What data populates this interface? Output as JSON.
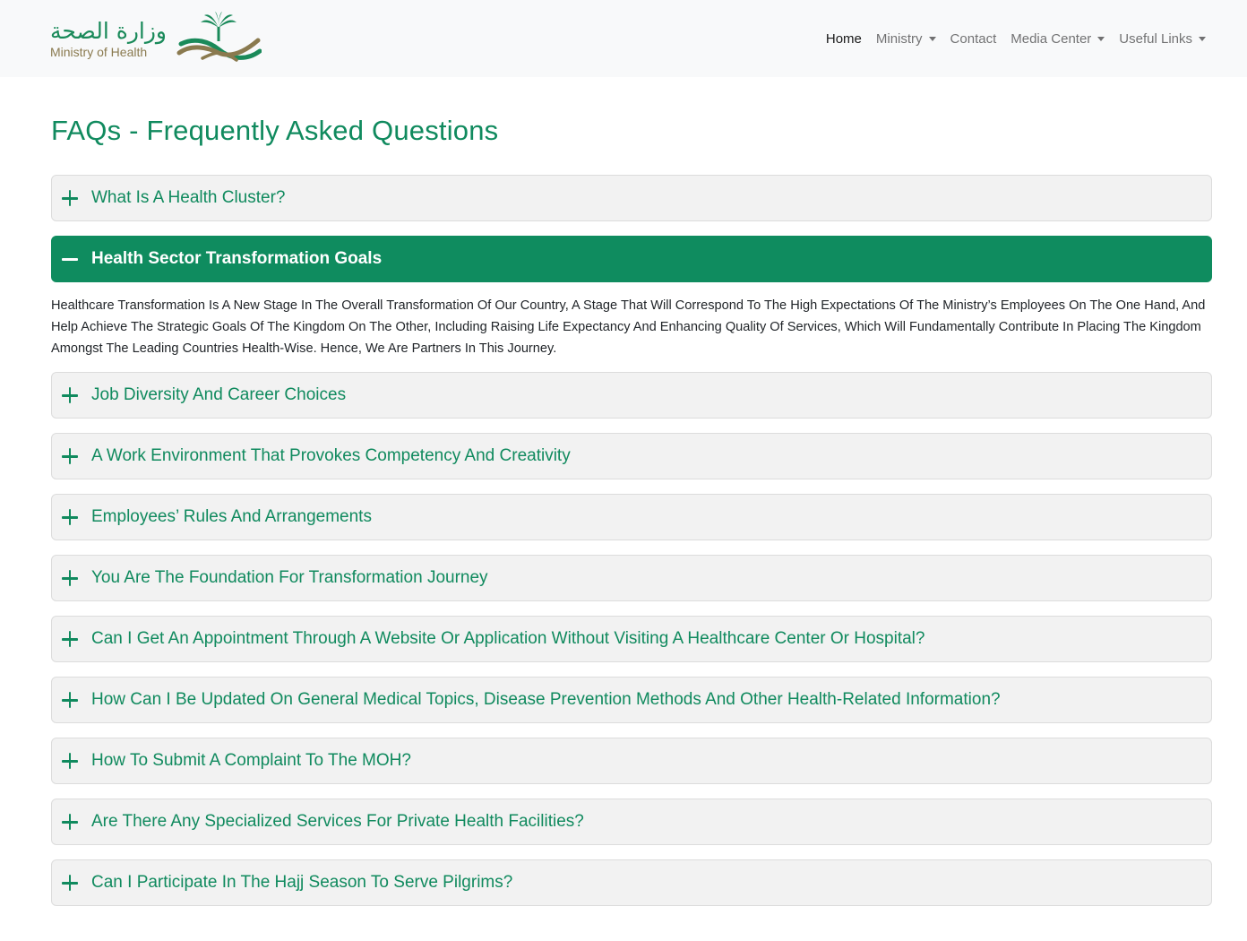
{
  "brand": {
    "arabic_name": "وزارة الصحة",
    "english_name": "Ministry of Health"
  },
  "nav": {
    "items": [
      {
        "label": "Home",
        "active": true,
        "dropdown": false
      },
      {
        "label": "Ministry",
        "active": false,
        "dropdown": true
      },
      {
        "label": "Contact",
        "active": false,
        "dropdown": false
      },
      {
        "label": "Media Center",
        "active": false,
        "dropdown": true
      },
      {
        "label": "Useful Links",
        "active": false,
        "dropdown": true
      }
    ]
  },
  "page": {
    "title": "FAQs - Frequently Asked Questions"
  },
  "faqs": [
    {
      "question": "What Is A Health Cluster?",
      "expanded": false
    },
    {
      "question": "Health Sector Transformation Goals",
      "expanded": true,
      "answer": "Healthcare Transformation Is A New Stage In The Overall Transformation Of Our Country, A Stage That Will Correspond To The High Expectations Of The Ministry’s Employees On The One Hand, And Help Achieve The Strategic Goals Of The Kingdom On The Other, Including Raising Life Expectancy And Enhancing Quality Of Services, Which Will Fundamentally Contribute In Placing The Kingdom Amongst The Leading Countries Health-Wise. Hence, We Are Partners In This Journey."
    },
    {
      "question": "Job Diversity And Career Choices",
      "expanded": false
    },
    {
      "question": "A Work Environment That Provokes Competency And Creativity",
      "expanded": false
    },
    {
      "question": "Employees’ Rules And Arrangements",
      "expanded": false
    },
    {
      "question": "You Are The Foundation For Transformation Journey",
      "expanded": false
    },
    {
      "question": "Can I Get An Appointment Through A Website Or Application Without Visiting A Healthcare Center Or Hospital?",
      "expanded": false
    },
    {
      "question": "How Can I Be Updated On General Medical Topics, Disease Prevention Methods And Other Health-Related Information?",
      "expanded": false
    },
    {
      "question": "How To Submit A Complaint To The MOH?",
      "expanded": false
    },
    {
      "question": "Are There Any Specialized Services For Private Health Facilities?",
      "expanded": false
    },
    {
      "question": "Can I Participate In The Hajj Season To Serve Pilgrims?",
      "expanded": false
    }
  ],
  "colors": {
    "primary_green": "#108a5e",
    "header_bg": "#f8f9fa",
    "collapsed_bg": "#f2f2f2",
    "logo_gold": "#8a7a4f"
  }
}
